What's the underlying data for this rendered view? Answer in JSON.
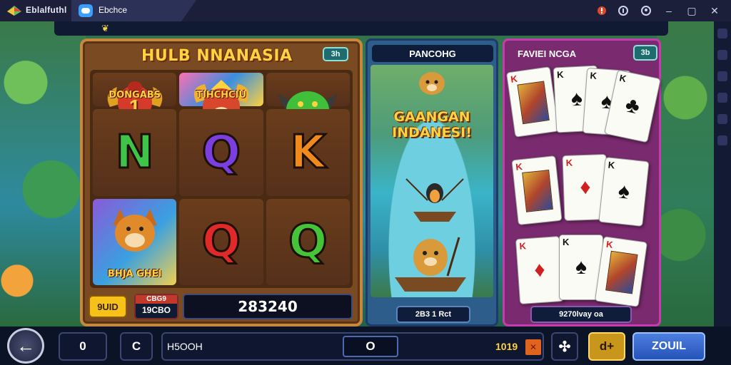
{
  "titlebar": {
    "app_name": "Eblalfuthl",
    "tab_label": "Ebchce",
    "controls": {
      "alert_icon": "alert-icon",
      "help_icon": "help-icon",
      "account_icon": "account-icon",
      "minimize": "–",
      "maximize": "▢",
      "close": "✕"
    }
  },
  "game": {
    "slot": {
      "title": "HULB NNANASIA",
      "badge": "3h",
      "symbols": [
        {
          "name": "rat-symbol",
          "label": "DONGABS",
          "big": "1"
        },
        {
          "name": "fox-symbol",
          "label": "TIHCHCIU"
        },
        {
          "name": "dragon-symbol",
          "label": ""
        },
        {
          "name": "letter-n",
          "letter": "N",
          "color": "#3fc44a"
        },
        {
          "name": "letter-q",
          "letter": "Q",
          "color": "#7b3ee0"
        },
        {
          "name": "letter-k",
          "letter": "K",
          "color": "#f08a1c"
        },
        {
          "name": "fox-card-symbol",
          "label": "BHJA GHEI"
        },
        {
          "name": "letter-q-red",
          "letter": "Q",
          "color": "#e02a2a"
        },
        {
          "name": "letter-q-green",
          "letter": "Q",
          "color": "#45c43a"
        }
      ],
      "footer": {
        "button": "9UID",
        "bet_top": "CBG9",
        "bet_bottom": "19CBO",
        "credit": "283240"
      }
    },
    "fishing": {
      "header": "PANCOHG",
      "title_line1": "GAANGAN",
      "title_line2": "INDANESI!",
      "footer": "2B3 1 Rct"
    },
    "cards": {
      "header": "FAVIEI NCGA",
      "badge": "3b",
      "footer": "9270lvay oa",
      "items": [
        {
          "rank": "K",
          "suit": "♦",
          "color": "#d21f1f",
          "face": true
        },
        {
          "rank": "K",
          "suit": "♠",
          "color": "#111111"
        },
        {
          "rank": "K",
          "suit": "♠",
          "color": "#111111"
        },
        {
          "rank": "K",
          "suit": "♣",
          "color": "#111111"
        },
        {
          "rank": "K",
          "suit": "♦",
          "color": "#d21f1f",
          "face": true
        },
        {
          "rank": "K",
          "suit": "♦",
          "color": "#d21f1f"
        },
        {
          "rank": "K",
          "suit": "♠",
          "color": "#111111"
        },
        {
          "rank": "K",
          "suit": "♦",
          "color": "#d21f1f"
        },
        {
          "rank": "K",
          "suit": "♠",
          "color": "#111111"
        },
        {
          "rank": "K",
          "suit": "♦",
          "color": "#d21f1f",
          "face": true
        }
      ]
    }
  },
  "bottombar": {
    "back_icon": "←",
    "counter": "0",
    "c_button": "C",
    "status_left": "H5OOH",
    "status_mid": "O",
    "status_right": "1019",
    "gear_icon": "✣",
    "plus_button": "d+",
    "zoom_button": "ZOUIL"
  },
  "colors": {
    "accent_gold": "#ffd23f",
    "slot_wood": "#7a4a22",
    "card_panel": "#7a2a6e",
    "fish_panel": "#2d5d8a",
    "bar": "#0b1327"
  }
}
